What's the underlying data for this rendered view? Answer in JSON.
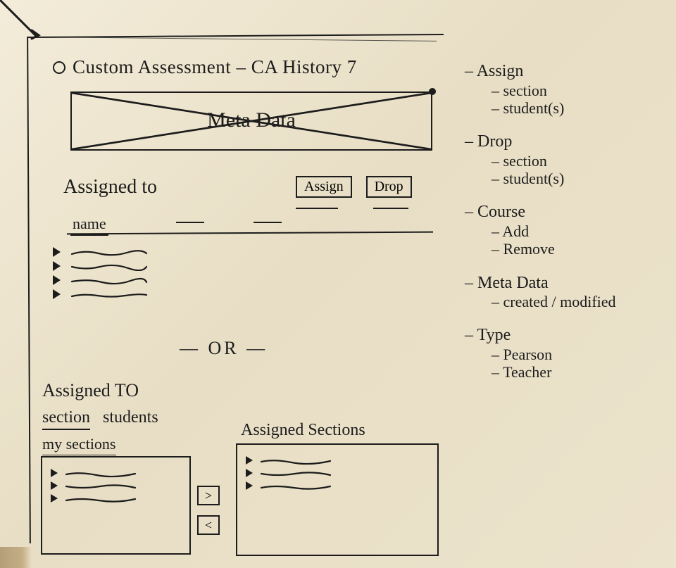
{
  "title": "Custom Assessment – CA History 7",
  "meta_box_label": "Meta Data",
  "assigned": {
    "heading": "Assigned to",
    "assign_btn": "Assign",
    "drop_btn": "Drop",
    "col_name": "name"
  },
  "or_separator": "— OR —",
  "alt": {
    "heading": "Assigned TO",
    "tab_section": "section",
    "tab_students": "students",
    "my_sections": "my sections",
    "assigned_sections": "Assigned Sections",
    "move_right": ">",
    "move_left": "<"
  },
  "notes": {
    "assign": {
      "h": "Assign",
      "a": "section",
      "b": "student(s)"
    },
    "drop": {
      "h": "Drop",
      "a": "section",
      "b": "student(s)"
    },
    "course": {
      "h": "Course",
      "a": "Add",
      "b": "Remove"
    },
    "meta": {
      "h": "Meta Data",
      "a": "created / modified"
    },
    "type": {
      "h": "Type",
      "a": "Pearson",
      "b": "Teacher"
    }
  }
}
